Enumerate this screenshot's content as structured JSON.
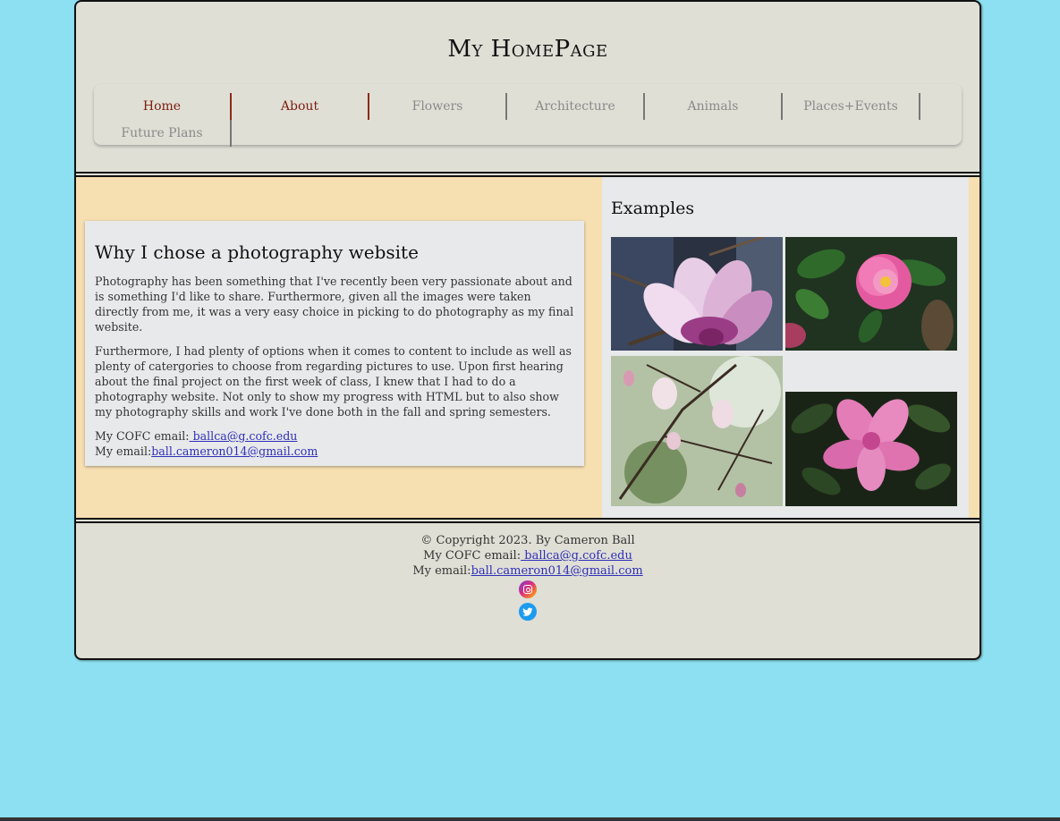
{
  "header": {
    "title": "My HomePage"
  },
  "nav": {
    "items": [
      "Home",
      "About",
      "Flowers",
      "Architecture",
      "Animals",
      "Places+Events",
      "Future Plans"
    ]
  },
  "main": {
    "card": {
      "heading": "Why I chose a photography website",
      "paragraphs": [
        "Photography has been something that I've recently been very passionate about and is something I'd like to share. Furthermore, given all the images were taken directly from me, it was a very easy choice in picking to do photography as my final website.",
        "Furthermore, I had plenty of options when it comes to content to include as well as plenty of catergories to choose from regarding pictures to use. Upon first hearing about the final project on the first week of class, I knew that I had to do a photography website. Not only to show my progress with HTML but to also show my photography skills and work I've done both in the fall and spring semesters."
      ],
      "cofc_label": "My COFC email:",
      "cofc_email": " ballca@g.cofc.edu",
      "email_label": "My email:",
      "email": "ball.cameron014@gmail.com"
    },
    "examples": {
      "title": "Examples"
    }
  },
  "footer": {
    "copyright": "© Copyright 2023. By Cameron Ball",
    "cofc_label": "My COFC email:",
    "cofc_email": " ballca@g.cofc.edu",
    "email_label": "My email:",
    "email": "ball.cameron014@gmail.com",
    "icons": [
      "instagram-icon",
      "twitter-icon"
    ]
  },
  "colors": {
    "background": "#8ce0f1",
    "page": "#e0dfd6",
    "main": "#f6dfb1",
    "card": "#e8e9ea",
    "nav_active": "#7a1e0e",
    "nav_inactive": "#8a8a8a",
    "link": "#2f2fb8"
  }
}
